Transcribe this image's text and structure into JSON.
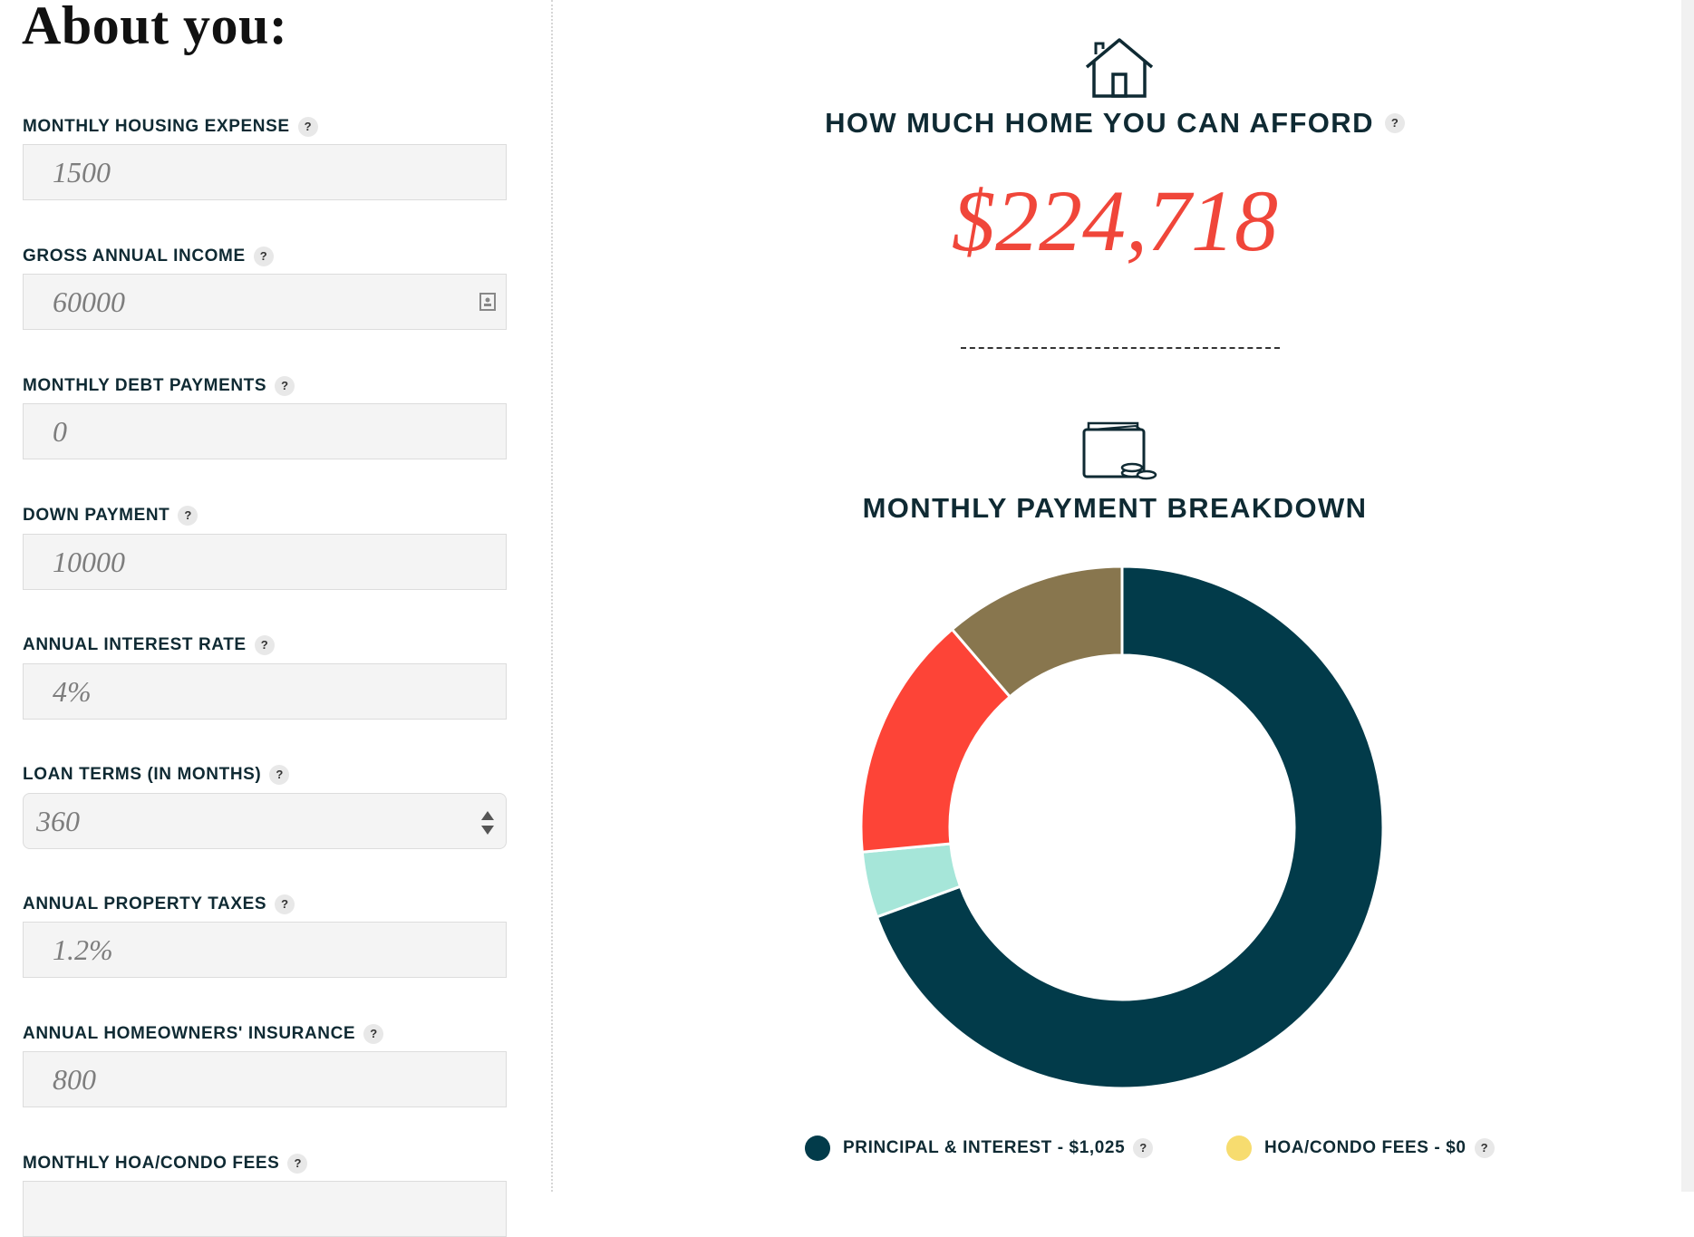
{
  "form": {
    "title": "About you:",
    "fields": [
      {
        "label": "MONTHLY HOUSING EXPENSE",
        "value": "1500"
      },
      {
        "label": "GROSS ANNUAL INCOME",
        "value": "60000"
      },
      {
        "label": "MONTHLY DEBT PAYMENTS",
        "value": "0"
      },
      {
        "label": "DOWN PAYMENT",
        "value": "10000"
      },
      {
        "label": "ANNUAL INTEREST RATE",
        "value": "4%"
      },
      {
        "label": "LOAN TERMS (IN MONTHS)",
        "value": "360"
      },
      {
        "label": "ANNUAL PROPERTY TAXES",
        "value": "1.2%"
      },
      {
        "label": "ANNUAL HOMEOWNERS' INSURANCE",
        "value": "800"
      },
      {
        "label": "MONTHLY HOA/CONDO FEES",
        "value": ""
      }
    ],
    "help_glyph": "?"
  },
  "result": {
    "heading": "HOW MUCH HOME YOU CAN AFFORD",
    "amount": "$224,718",
    "icon": "house-icon"
  },
  "breakdown": {
    "heading": "MONTHLY PAYMENT BREAKDOWN",
    "icon": "wallet-icon",
    "legend": [
      {
        "label": "PRINCIPAL & INTEREST - $1,025",
        "color": "#023b4a"
      },
      {
        "label": "HOA/CONDO FEES - $0",
        "color": "#f7dc6f"
      }
    ]
  },
  "chart_data": {
    "type": "pie",
    "donut": true,
    "slices": [
      {
        "value": 1025,
        "color": "#023b4a"
      },
      {
        "value": 60,
        "color": "#a6e6d9"
      },
      {
        "value": 224.72,
        "color": "#fd4437"
      },
      {
        "value": 166.67,
        "color": "#88764e"
      }
    ]
  }
}
